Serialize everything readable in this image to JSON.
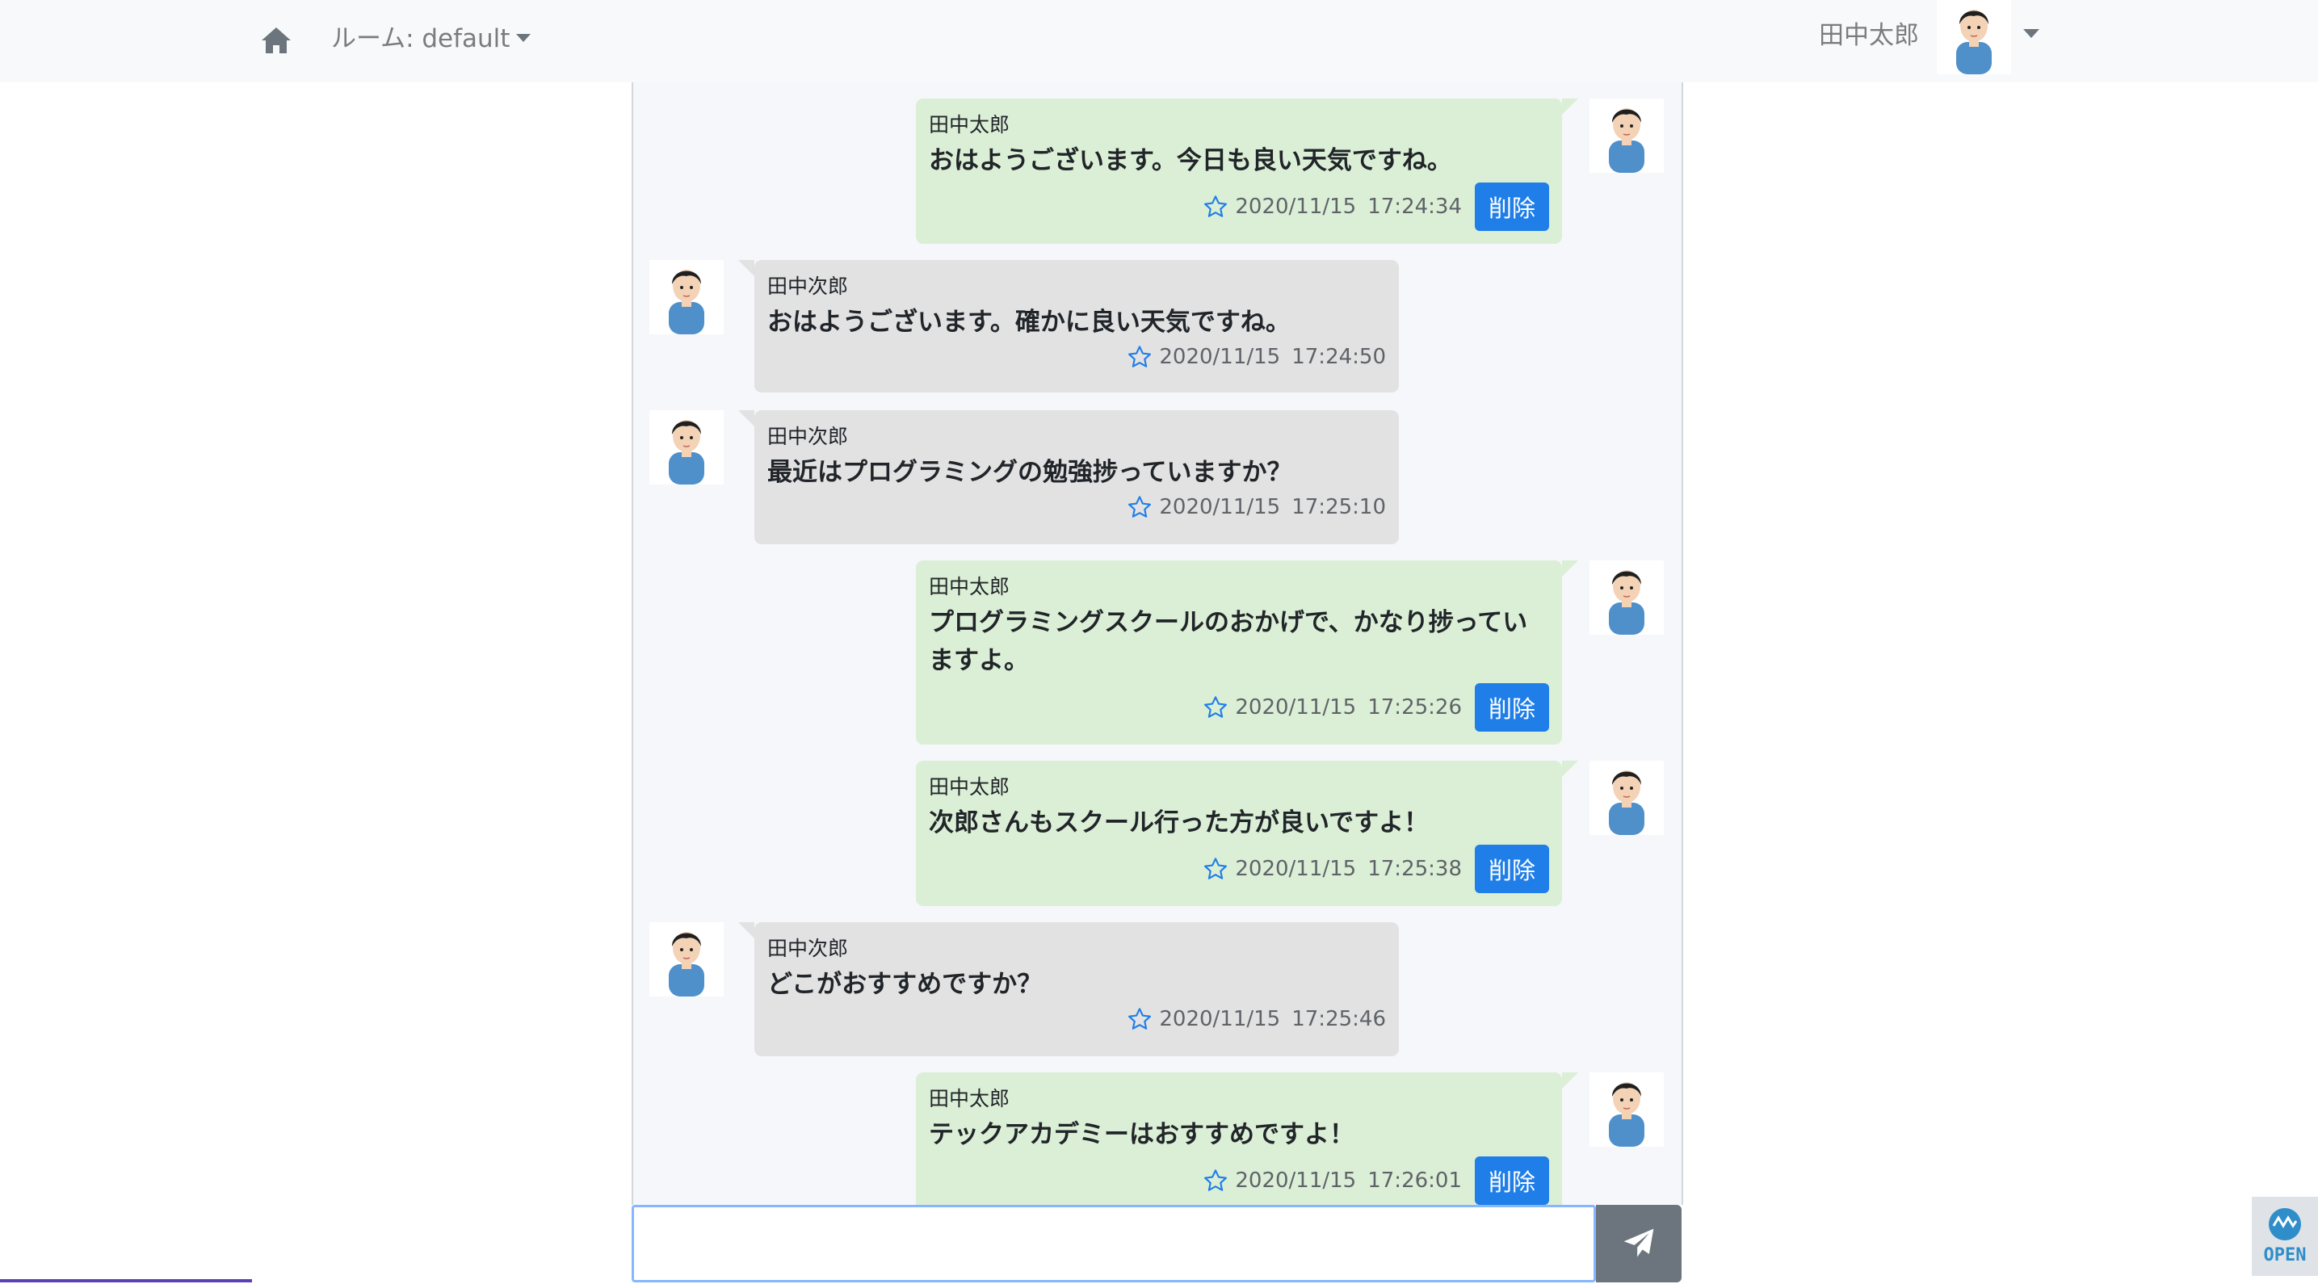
{
  "navbar": {
    "room_label": "ルーム: default",
    "user_name": "田中太郎",
    "icons": {
      "home": "home-icon",
      "caret": "caret-down-icon",
      "avatar": "user-avatar"
    }
  },
  "messages": [
    {
      "sender": "田中太郎",
      "text": "おはようございます。今日も良い天気ですね。",
      "date": "2020/11/15",
      "time": "17:24:34",
      "delete_label": "削除",
      "mine": true
    },
    {
      "sender": "田中次郎",
      "text": "おはようございます。確かに良い天気ですね。",
      "date": "2020/11/15",
      "time": "17:24:50",
      "mine": false
    },
    {
      "sender": "田中次郎",
      "text": "最近はプログラミングの勉強捗っていますか？",
      "date": "2020/11/15",
      "time": "17:25:10",
      "mine": false
    },
    {
      "sender": "田中太郎",
      "text": "プログラミングスクールのおかげで、かなり捗っていますよ。",
      "date": "2020/11/15",
      "time": "17:25:26",
      "delete_label": "削除",
      "mine": true
    },
    {
      "sender": "田中太郎",
      "text": "次郎さんもスクール行った方が良いですよ！",
      "date": "2020/11/15",
      "time": "17:25:38",
      "delete_label": "削除",
      "mine": true
    },
    {
      "sender": "田中次郎",
      "text": "どこがおすすめですか？",
      "date": "2020/11/15",
      "time": "17:25:46",
      "mine": false
    },
    {
      "sender": "田中太郎",
      "text": "テックアカデミーはおすすめですよ！",
      "date": "2020/11/15",
      "time": "17:26:01",
      "delete_label": "削除",
      "mine": true
    }
  ],
  "composer": {
    "value": "",
    "placeholder": "",
    "send_icon": "paper-plane-icon"
  },
  "widget": {
    "label": "OPEN",
    "icon": "open-widget-icon"
  },
  "colors": {
    "my_bubble": "#dbefd6",
    "other_bubble": "#e2e2e3",
    "delete_button": "#1f7ee8",
    "star": "#1f7ee8",
    "send_button": "#6c757d",
    "input_border": "#86b7fe"
  }
}
